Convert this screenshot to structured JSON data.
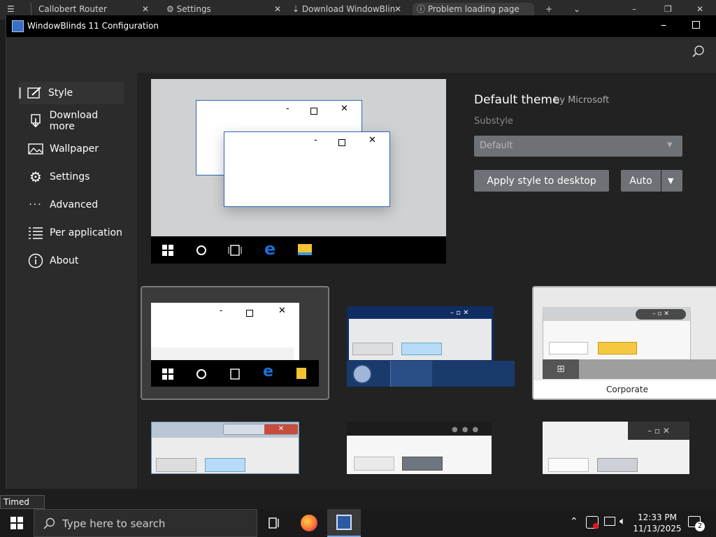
{
  "browser_tabs": [
    {
      "title": "Callobert Router"
    },
    {
      "title": "Settings"
    },
    {
      "title": "Download WindowBlin"
    },
    {
      "title": "Problem loading page"
    }
  ],
  "window": {
    "title": "WindowBlinds 11 Configuration"
  },
  "sidebar": {
    "items": [
      {
        "label": "Style",
        "icon": "style-icon",
        "selected": true
      },
      {
        "label": "Download more",
        "icon": "download-icon"
      },
      {
        "label": "Wallpaper",
        "icon": "wallpaper-icon"
      },
      {
        "label": "Settings",
        "icon": "gear-icon"
      },
      {
        "label": "Advanced",
        "icon": "more-icon"
      },
      {
        "label": "Per application",
        "icon": "list-icon"
      },
      {
        "label": "About",
        "icon": "info-icon"
      }
    ]
  },
  "theme": {
    "name": "Default theme",
    "author": "by Microsoft",
    "substyle_label": "Substyle",
    "substyle_value": "Default",
    "apply_label": "Apply style to desktop",
    "auto_label": "Auto"
  },
  "gallery": {
    "corporate_label": "Corporate"
  },
  "tooltip": "Timed Out",
  "taskbar": {
    "search_placeholder": "Type here to search",
    "time": "12:33 PM",
    "date": "11/13/2025",
    "notification_count": "2"
  },
  "colors": {
    "accent": "#1a6fd6",
    "panel": "#2b2b2b",
    "button": "#6e7175"
  }
}
